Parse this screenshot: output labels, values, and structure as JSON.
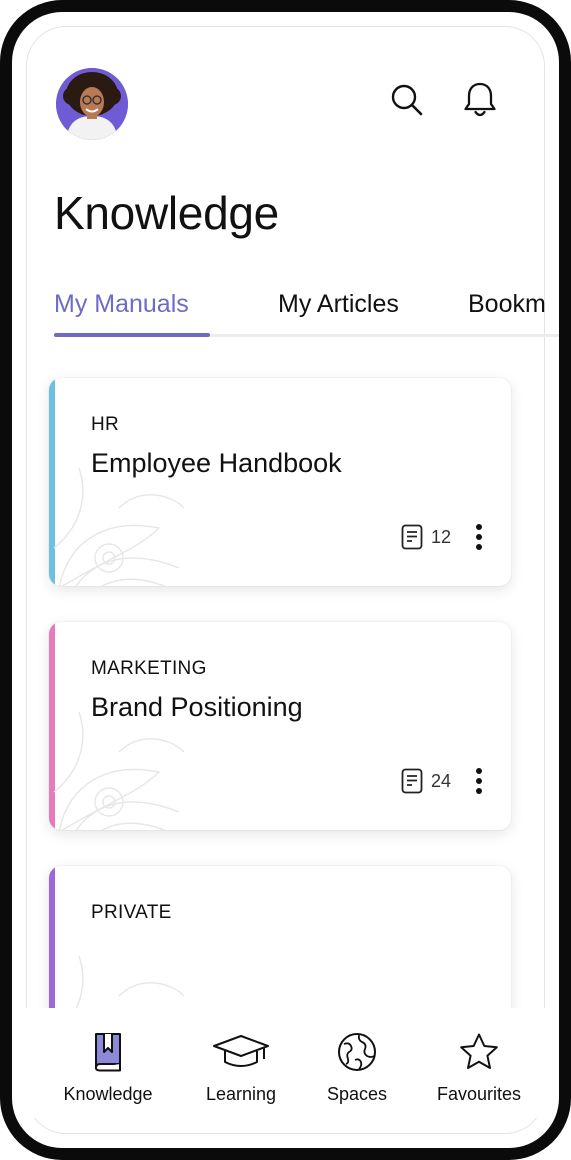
{
  "header": {
    "avatar_icon": "user-avatar",
    "search_icon": "search-icon",
    "notification_icon": "bell-icon",
    "title": "Knowledge"
  },
  "tabs": [
    {
      "label": "My Manuals",
      "active": true
    },
    {
      "label": "My Articles",
      "active": false
    },
    {
      "label": "Bookm",
      "active": false
    }
  ],
  "manuals": [
    {
      "category": "HR",
      "title": "Employee Handbook",
      "count": "12",
      "accent": "#6ec0e0"
    },
    {
      "category": "MARKETING",
      "title": "Brand Positioning",
      "count": "24",
      "accent": "#e47bbd"
    },
    {
      "category": "PRIVATE",
      "title": "",
      "count": "",
      "accent": "#9b6ad6"
    }
  ],
  "bottom_nav": [
    {
      "label": "Knowledge",
      "icon": "book-icon",
      "active": true
    },
    {
      "label": "Learning",
      "icon": "graduation-cap-icon",
      "active": false
    },
    {
      "label": "Spaces",
      "icon": "globe-icon",
      "active": false
    },
    {
      "label": "Favourites",
      "icon": "star-icon",
      "active": false
    }
  ],
  "colors": {
    "primary": "#6d6bc6",
    "active_nav_icon": "#8c89d8",
    "text": "#111111"
  }
}
